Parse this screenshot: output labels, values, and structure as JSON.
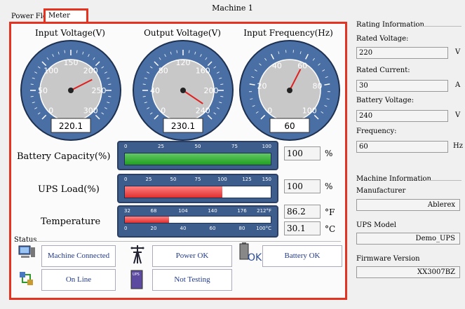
{
  "window": {
    "title": "Machine 1"
  },
  "tabs": {
    "power_flow": "Power Flow",
    "meter": "Meter"
  },
  "gauges": [
    {
      "title": "Input Voltage(V)",
      "ticks": [
        "0",
        "50",
        "100",
        "150",
        "200",
        "250",
        "300"
      ],
      "min": 0,
      "max": 300,
      "value": 220.1,
      "display": "220.1"
    },
    {
      "title": "Output Voltage(V)",
      "ticks": [
        "0",
        "40",
        "80",
        "120",
        "160",
        "200",
        "240"
      ],
      "min": 0,
      "max": 240,
      "value": 230.1,
      "display": "230.1"
    },
    {
      "title": "Input Frequency(Hz)",
      "ticks": [
        "0",
        "20",
        "40",
        "60",
        "80",
        "100"
      ],
      "min": 0,
      "max": 100,
      "value": 60,
      "display": "60"
    }
  ],
  "battery": {
    "label": "Battery Capacity(%)",
    "ticks": [
      "0",
      "25",
      "50",
      "75",
      "100"
    ],
    "value": "100",
    "unit": "%",
    "fill_fraction": 1.0
  },
  "ups_load": {
    "label": "UPS Load(%)",
    "ticks": [
      "0",
      "25",
      "50",
      "75",
      "100",
      "125",
      "150"
    ],
    "value": "100",
    "unit": "%",
    "fill_fraction": 0.667
  },
  "temperature": {
    "label": "Temperature",
    "ticks_f": [
      "32",
      "68",
      "104",
      "140",
      "176",
      "212°F"
    ],
    "ticks_c": [
      "0",
      "20",
      "40",
      "60",
      "80",
      "100°C"
    ],
    "value_f": "86.2",
    "unit_f": "°F",
    "value_c": "30.1",
    "unit_c": "°C",
    "fill_fraction": 0.301
  },
  "status": {
    "title": "Status",
    "items": [
      "Machine Connected",
      "Power OK",
      "Battery OK",
      "On Line",
      "Not Testing"
    ],
    "battery_icon_text": "OK",
    "ups_icon_text": "UPS"
  },
  "rating": {
    "title": "Rating Information",
    "rated_voltage_label": "Rated Voltage:",
    "rated_voltage": "220",
    "rated_voltage_unit": "V",
    "rated_current_label": "Rated Current:",
    "rated_current": "30",
    "rated_current_unit": "A",
    "battery_voltage_label": "Battery Voltage:",
    "battery_voltage": "240",
    "battery_voltage_unit": "V",
    "frequency_label": "Frequency:",
    "frequency": "60",
    "frequency_unit": "Hz"
  },
  "machine": {
    "title": "Machine Information",
    "manufacturer_label": "Manufacturer",
    "manufacturer": "Ablerex",
    "model_label": "UPS Model",
    "model": "Demo_UPS",
    "firmware_label": "Firmware Version",
    "firmware": "XX3007BZ"
  }
}
